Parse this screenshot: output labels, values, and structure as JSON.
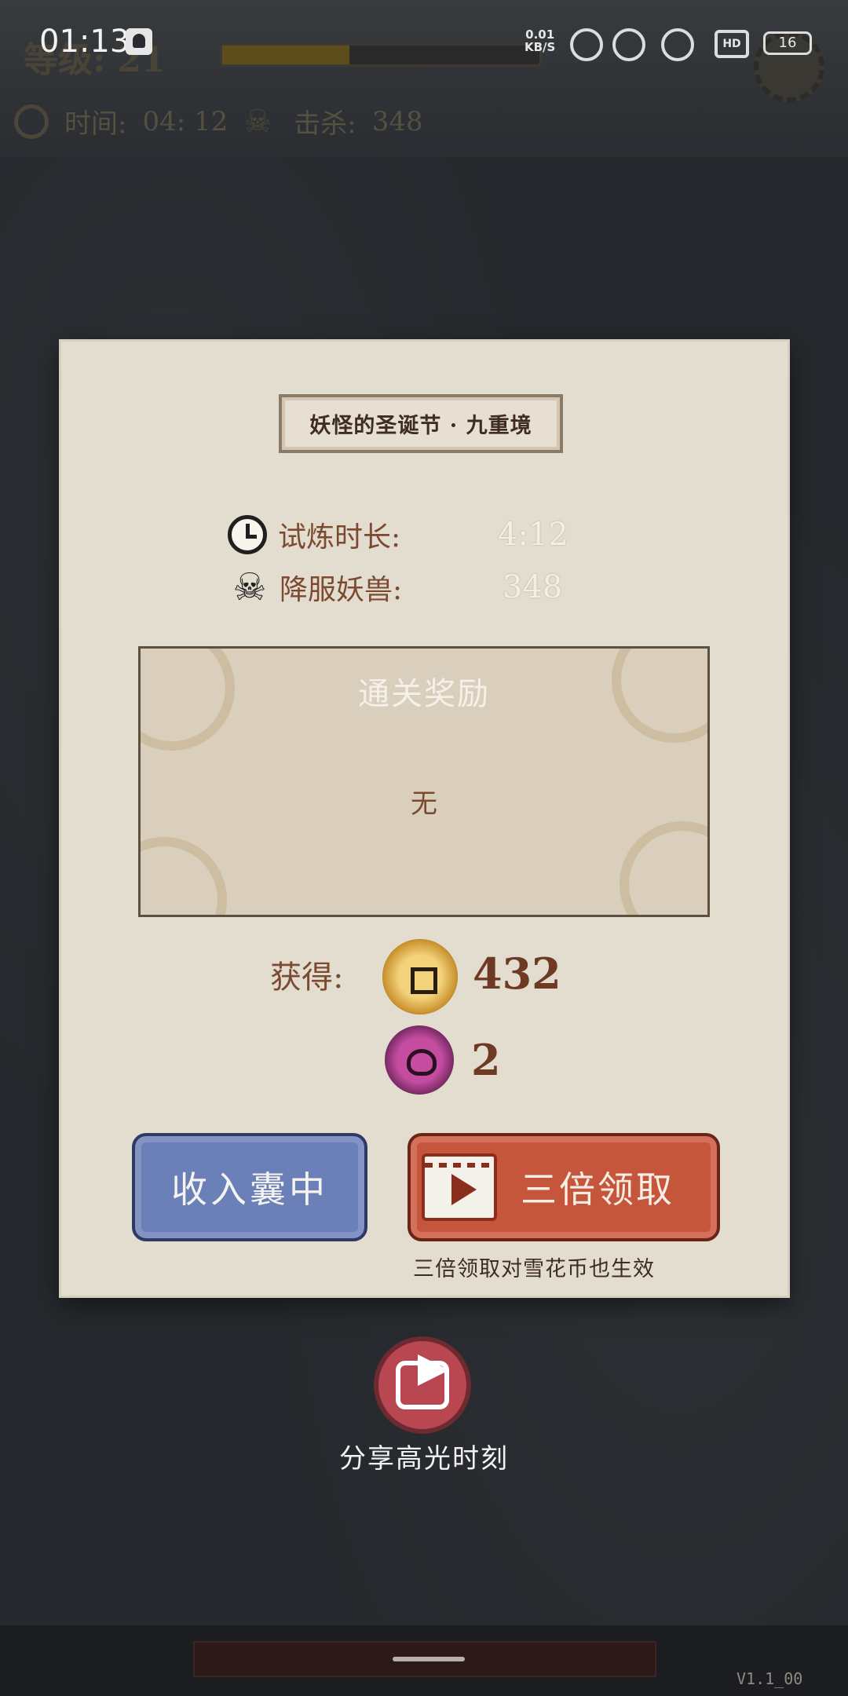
{
  "status_bar": {
    "time": "01:13",
    "net_speed_value": "0.01",
    "net_speed_unit": "KB/S",
    "battery": "16",
    "hd_label": "HD"
  },
  "background": {
    "level": "等级: 21",
    "time_label": "时间:",
    "time_value": "04: 12",
    "kills_label": "击杀:",
    "kills_value": "348",
    "xp_fill_percent": 40
  },
  "dialog": {
    "title": "妖怪的圣诞节 · 九重境",
    "stats": [
      {
        "label": "试炼时长:",
        "value": "4:12",
        "icon": "clock-icon"
      },
      {
        "label": "降服妖兽:",
        "value": "348",
        "icon": "skull-icon"
      }
    ],
    "reward": {
      "title": "通关奖励",
      "content": "无"
    },
    "gain": {
      "label": "获得:",
      "coin_value": "432",
      "gem_value": "2"
    },
    "buttons": {
      "collect": "收入囊中",
      "triple": "三倍领取",
      "triple_note": "三倍领取对雪花币也生效"
    }
  },
  "share": {
    "label": "分享高光时刻"
  },
  "version": "V1.1_00",
  "colors": {
    "panel": "#e3ddd0",
    "collect_button": "#6b7fb8",
    "triple_button": "#c5553b",
    "share_button": "#b94751"
  }
}
